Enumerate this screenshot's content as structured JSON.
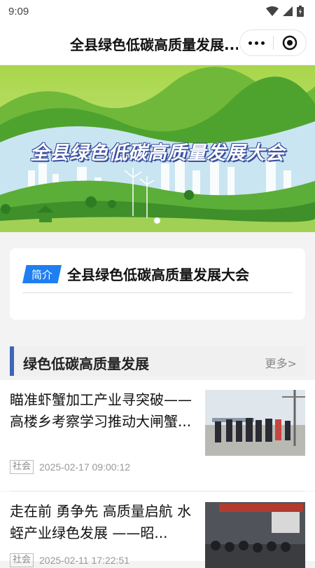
{
  "status": {
    "time": "9:09"
  },
  "header": {
    "title": "全县绿色低碳高质量发展..."
  },
  "banner": {
    "title": "全县绿色低碳高质量发展大会"
  },
  "intro": {
    "tag": "简介",
    "title": "全县绿色低碳高质量发展大会"
  },
  "section": {
    "title": "绿色低碳高质量发展",
    "more": "更多>"
  },
  "news": [
    {
      "title": "瞄准虾蟹加工产业寻突破——高楼乡考察学习推动大闸蟹...",
      "tag": "社会",
      "date": "2025-02-17 09:00:12"
    },
    {
      "title": "走在前 勇争先 高质量启航 水蛭产业绿色发展 ——昭...",
      "tag": "社会",
      "date": "2025-02-11 17:22:51"
    }
  ],
  "colors": {
    "accent": "#1f7ff0",
    "section_bar": "#3e66b8",
    "banner_green": "#8cc63f"
  }
}
